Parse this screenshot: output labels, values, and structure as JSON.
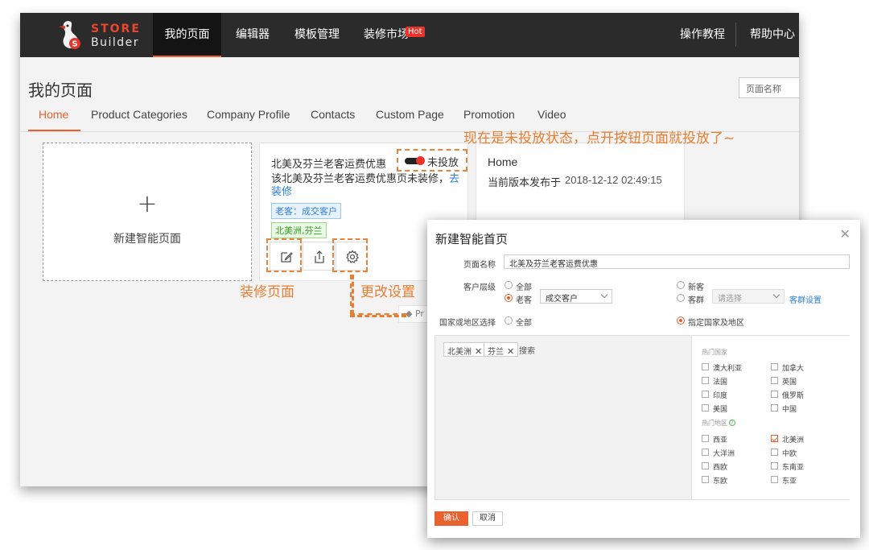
{
  "brand": {
    "store": "STORE",
    "builder": "Builder"
  },
  "nav": {
    "items": [
      "我的页面",
      "编辑器",
      "模板管理",
      "装修市场"
    ],
    "hot": "Hot",
    "right": [
      "操作教程",
      "帮助中心"
    ]
  },
  "page": {
    "title": "我的页面",
    "search_placeholder": "页面名称",
    "tabs": [
      "Home",
      "Product Categories",
      "Company Profile",
      "Contacts",
      "Custom Page",
      "Promotion",
      "Video"
    ]
  },
  "cards": {
    "new_page": {
      "plus": "+",
      "label": "新建智能页面"
    },
    "smart_page": {
      "title": "北美及芬兰老客运费优惠",
      "status": "未投放",
      "desc": "该北美及芬兰老客运费优惠页未装修，",
      "desc_link": "去装修",
      "tag_customer": "老客：成交客户",
      "tag_region": "北美洲,芬兰"
    },
    "home": {
      "title": "Home",
      "date_label": "当前版本发布于",
      "date": "2018-12-12 02:49:15"
    }
  },
  "annotations": {
    "status_note": "现在是未投放状态，点开按钮页面就投放了~",
    "decorate": "装修页面",
    "settings": "更改设置"
  },
  "behind_button": "◆ Pr",
  "modal": {
    "title": "新建智能首页",
    "close": "✕",
    "page_name_label": "页面名称",
    "page_name_value": "北美及芬兰老客运费优惠",
    "customer_level_label": "客户层级",
    "opt_all": "全部",
    "opt_old": "老客",
    "old_select": "成交客户",
    "opt_new": "新客",
    "opt_group": "客群",
    "group_select_placeholder": "请选择",
    "group_settings_link": "客群设置",
    "region_label": "国家或地区选择",
    "region_all": "全部",
    "region_specified": "指定国家及地区",
    "chips": [
      "北美洲",
      "芬兰"
    ],
    "search": "搜索",
    "hot_countries_title": "热门国家",
    "countries": [
      {
        "name": "澳大利亚",
        "checked": false
      },
      {
        "name": "加拿大",
        "checked": false
      },
      {
        "name": "法国",
        "checked": false
      },
      {
        "name": "英国",
        "checked": false
      },
      {
        "name": "印度",
        "checked": false
      },
      {
        "name": "俄罗斯",
        "checked": false
      },
      {
        "name": "美国",
        "checked": false
      },
      {
        "name": "中国",
        "checked": false
      }
    ],
    "hot_regions_title": "热门地区",
    "regions": [
      {
        "name": "西亚",
        "checked": false
      },
      {
        "name": "北美洲",
        "checked": true
      },
      {
        "name": "大洋洲",
        "checked": false
      },
      {
        "name": "中欧",
        "checked": false
      },
      {
        "name": "西欧",
        "checked": false
      },
      {
        "name": "东南亚",
        "checked": false
      },
      {
        "name": "东欧",
        "checked": false
      },
      {
        "name": "东亚",
        "checked": false
      }
    ],
    "ok": "确认",
    "cancel": "取消"
  },
  "colors": {
    "accent": "#e8612f",
    "annotation": "#ea7d2f",
    "link": "#2d7fd8",
    "topbar": "#2b2b2b"
  }
}
